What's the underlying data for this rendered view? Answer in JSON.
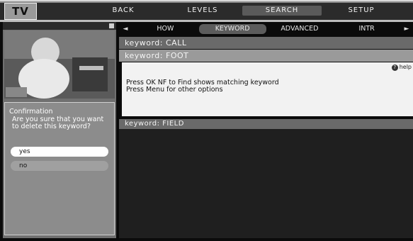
{
  "app": {
    "logo": "TV"
  },
  "topnav": [
    {
      "label": "BACK",
      "active": false
    },
    {
      "label": "LEVELS",
      "active": false
    },
    {
      "label": "SEARCH",
      "active": true
    },
    {
      "label": "SETUP",
      "active": false
    }
  ],
  "tabs": [
    "HOW",
    "KEYWORD",
    "ADVANCED",
    "INTR"
  ],
  "keywords": {
    "row1": "keyword: CALL",
    "row2": "keyword: FOOT",
    "row3": "keyword: FIELD"
  },
  "panel": {
    "help_label": "help",
    "message_line1": "Press OK NF to Find shows matching keyword",
    "message_line2": "Press Menu for other options"
  },
  "confirmation": {
    "title": "Confirmation",
    "question": "Are you sure that you want to delete this keyword?",
    "yes": "yes",
    "no": "no"
  }
}
